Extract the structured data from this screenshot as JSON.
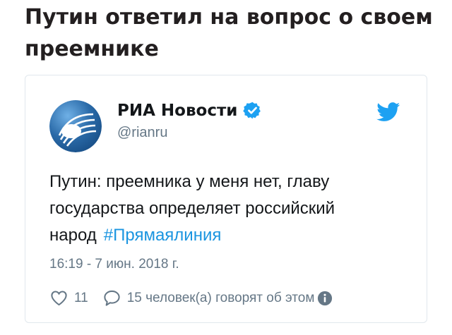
{
  "article": {
    "headline": "Путин ответил на вопрос о своем преемнике"
  },
  "tweet": {
    "author_name": "РИА Новости",
    "handle": "@rianru",
    "text": "Путин: преемника у меня нет, главу государства определяет российский народ",
    "hashtag": "#Прямаялиния",
    "timestamp": "16:19 - 7 июн. 2018 г.",
    "likes": "11",
    "replies_text": "15 человек(а) говорят об этом"
  },
  "colors": {
    "link": "#1b95e0",
    "muted": "#657786",
    "border": "#e1e8ed",
    "avatar": "#2a6aa8"
  },
  "icons": {
    "avatar": "ria-novosti-logo",
    "verified": "verified-badge-icon",
    "brand": "twitter-bird-icon",
    "like": "heart-icon",
    "reply": "speech-bubble-icon",
    "info": "info-icon"
  }
}
